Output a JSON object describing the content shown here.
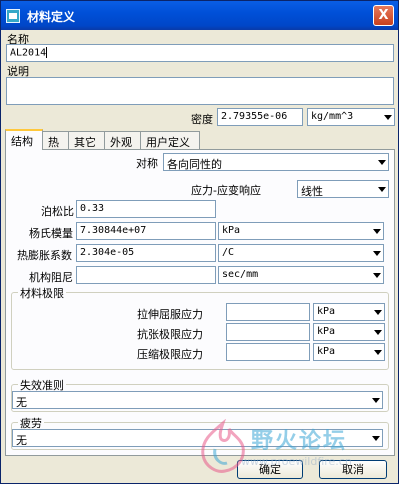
{
  "window": {
    "title": "材料定义",
    "close_glyph": "X"
  },
  "name": {
    "label": "名称",
    "value": "AL2014"
  },
  "description": {
    "label": "说明",
    "value": ""
  },
  "density": {
    "label": "密度",
    "value": "2.79355e-06",
    "unit": "kg/mm^3"
  },
  "tabs": [
    {
      "label": "结构",
      "active": true
    },
    {
      "label": "热"
    },
    {
      "label": "其它"
    },
    {
      "label": "外观"
    },
    {
      "label": "用户定义"
    }
  ],
  "structure": {
    "symmetry": {
      "label": "对称",
      "value": "各向同性的"
    },
    "stress_strain": {
      "label": "应力-应变响应",
      "value": "线性"
    },
    "poisson": {
      "label": "泊松比",
      "value": "0.33"
    },
    "youngs": {
      "label": "杨氏模量",
      "value": "7.30844e+07",
      "unit": "kPa"
    },
    "thermal_expansion": {
      "label": "热膨胀系数",
      "value": "2.304e-05",
      "unit": "/C"
    },
    "damping": {
      "label": "机构阻尼",
      "value": "",
      "unit": "sec/mm"
    }
  },
  "limits": {
    "title": "材料极限",
    "tensile": {
      "label": "拉伸屈服应力",
      "value": "",
      "unit": "kPa"
    },
    "tension_limit": {
      "label": "抗张极限应力",
      "value": "",
      "unit": "kPa"
    },
    "compression": {
      "label": "压缩极限应力",
      "value": "",
      "unit": "kPa"
    }
  },
  "failure": {
    "title": "失效准则",
    "value": "无"
  },
  "fatigue": {
    "title": "疲劳",
    "value": "无"
  },
  "buttons": {
    "ok": "确定",
    "cancel": "取消"
  },
  "watermark": {
    "text": "野火论坛",
    "url": "www.proewildfire.cn"
  },
  "colors": {
    "titlebar": "#0054e3",
    "accent_tab": "#ffc83c",
    "watermark": "#3ea7d6"
  }
}
